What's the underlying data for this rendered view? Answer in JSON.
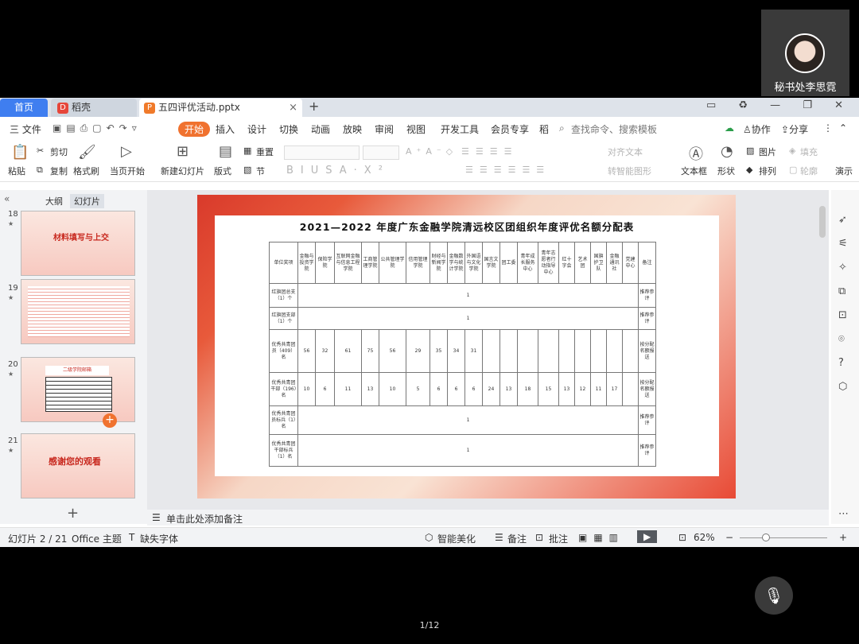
{
  "video": {
    "name": "秘书处李思霓"
  },
  "tabs": {
    "home": "首页",
    "docer": "稻壳",
    "file": "五四评优活动.pptx",
    "close": "×",
    "plus": "+"
  },
  "window_controls": "▭ ♻ — ❐ ✕",
  "menu": {
    "file": "三 文件",
    "start": "开始",
    "insert": "插入",
    "design": "设计",
    "switch": "切换",
    "animation": "动画",
    "slideshow": "放映",
    "review": "审阅",
    "view": "视图",
    "dev": "开发工具",
    "member": "会员专享",
    "more": "稻",
    "search": "查找命令、搜索模板",
    "collab": "协作",
    "share": "分享"
  },
  "ribbon": {
    "paste": "粘贴",
    "cut": "剪切",
    "copy": "复制",
    "format_painter": "格式刷",
    "from_current": "当页开始",
    "new_slide": "新建幻灯片",
    "layout": "版式",
    "section": "节",
    "reset": "重置",
    "align_text": "对齐文本",
    "convert_smartart": "转智能图形",
    "textbox": "文本框",
    "shape": "形状",
    "picture": "图片",
    "fill": "填充",
    "arrange": "排列",
    "outline": "轮廓",
    "present": "演示"
  },
  "left": {
    "outline": "大纲",
    "slides": "幻灯片",
    "add": "+"
  },
  "thumbs": [
    {
      "num": "18",
      "text": "材料填写与上交"
    },
    {
      "num": "19",
      "text": ""
    },
    {
      "num": "20",
      "text": "二级学院邮箱"
    },
    {
      "num": "21",
      "text": "感谢您的观看"
    }
  ],
  "slide": {
    "title": "2021—2022 年度广东金融学院清远校区团组织年度评优名额分配表",
    "headers": [
      "单位奖项",
      "金融与投资学院",
      "保险学院",
      "互联网金融与信息工程学院",
      "工商管理学院",
      "公共管理学院",
      "信用管理学院",
      "财经与新闻学院",
      "金融数学与统计学院",
      "外国语与文化学院",
      "国言文学院",
      "团工委",
      "青年成长服务中心",
      "青年志愿者行动指导中心",
      "红十字会",
      "艺术团",
      "国旗护卫队",
      "金融通讯社",
      "党建中心",
      "备注"
    ],
    "rows": [
      {
        "label": "红旗团总支（1）个",
        "merged": "1",
        "note": "推荐参评"
      },
      {
        "label": "红旗团支部（1）个",
        "merged": "1",
        "note": "推荐参评"
      },
      {
        "label": "优秀共青团员（409）名",
        "cells": [
          "56",
          "32",
          "61",
          "75",
          "56",
          "29",
          "35",
          "34",
          "31",
          "",
          "",
          "",
          "",
          "",
          "",
          "",
          "",
          ""
        ],
        "note": "按分配名额报送"
      },
      {
        "label": "优秀共青团干部（196）名",
        "cells": [
          "10",
          "6",
          "11",
          "13",
          "10",
          "5",
          "6",
          "6",
          "6",
          "24",
          "13",
          "18",
          "15",
          "13",
          "12",
          "11",
          "17",
          ""
        ],
        "note": "按分配名额报送"
      },
      {
        "label": "优秀共青团员标兵（1）名",
        "merged": "1",
        "note": "推荐参评"
      },
      {
        "label": "优秀共青团干部标兵（1）名",
        "merged": "1",
        "note": "推荐参评"
      }
    ]
  },
  "notes": "单击此处添加备注",
  "status": {
    "slide": "幻灯片 2 / 21",
    "theme": "Office 主题",
    "missing_font": "缺失字体",
    "beautify": "智能美化",
    "notes": "备注",
    "comment": "批注",
    "zoom": "62%"
  },
  "pager": "1/12"
}
